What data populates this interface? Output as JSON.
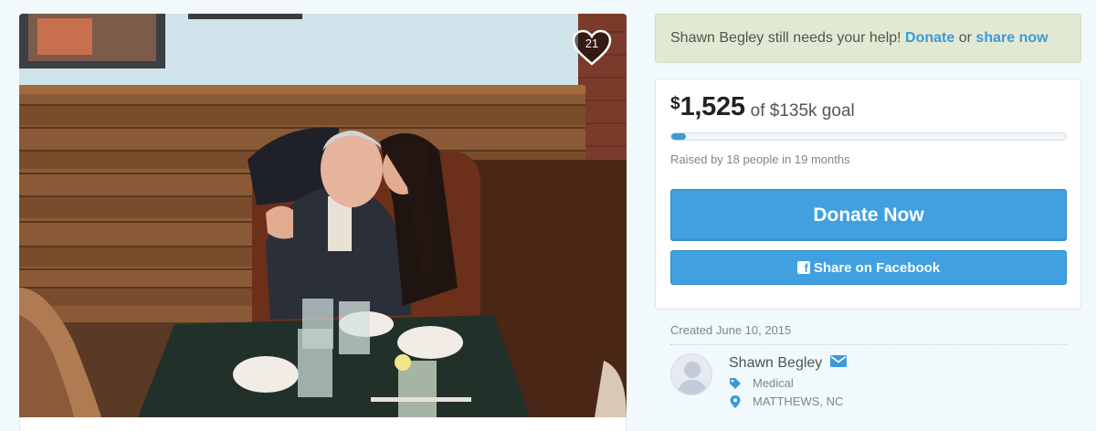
{
  "photo": {
    "description_icon": "campaign-photo",
    "heart_count": "21",
    "heart_icon": "heart-icon"
  },
  "help_banner": {
    "prefix": "Shawn Begley still needs your help!",
    "donate_link": "Donate",
    "or_text": "or",
    "share_link": "share now"
  },
  "progress": {
    "currency_symbol": "$",
    "raised_amount": "1,525",
    "goal_text": "of $135k goal",
    "fraction_raised": 0.0113,
    "raised_by": "Raised by 18 people in 19 months"
  },
  "buttons": {
    "donate_now": "Donate Now",
    "share_facebook": "Share on Facebook",
    "facebook_icon": "facebook-icon"
  },
  "organizer": {
    "created": "Created June 10, 2015",
    "name": "Shawn Begley",
    "category": "Medical",
    "location": "MATTHEWS, NC",
    "icons": [
      "avatar-placeholder-icon",
      "mail-icon",
      "tag-icon",
      "location-pin-icon"
    ]
  },
  "colors": {
    "accent": "#40a0e0",
    "link": "#3d9ad7",
    "banner_bg": "#e2e9d3",
    "page_bg": "#f2f9fd"
  }
}
